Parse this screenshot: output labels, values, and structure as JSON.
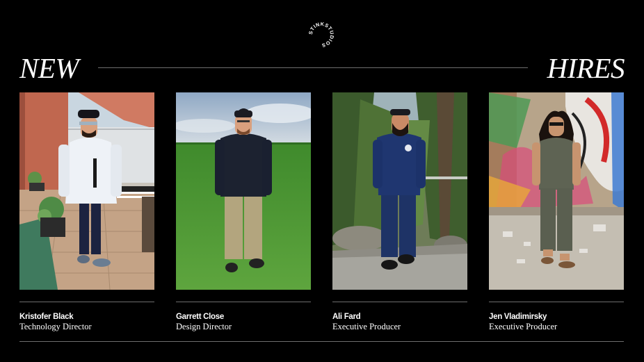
{
  "brand": {
    "logo_text": "STINKSTUDIOS",
    "logo_icon": "circular-wordmark-icon"
  },
  "headline": {
    "left": "NEW",
    "right": "HIRES"
  },
  "hires": [
    {
      "name": "Kristofer Black",
      "role": "Technology Director",
      "photo_icon": "person-photo-rooftop"
    },
    {
      "name": "Garrett Close",
      "role": "Design Director",
      "photo_icon": "person-photo-field"
    },
    {
      "name": "Ali Fard",
      "role": "Executive Producer",
      "photo_icon": "person-photo-forest"
    },
    {
      "name": "Jen Vladimirsky",
      "role": "Executive Producer",
      "photo_icon": "person-photo-graffiti"
    }
  ],
  "colors": {
    "background": "#000000",
    "text": "#ffffff",
    "rule": "#6e6e6e"
  }
}
